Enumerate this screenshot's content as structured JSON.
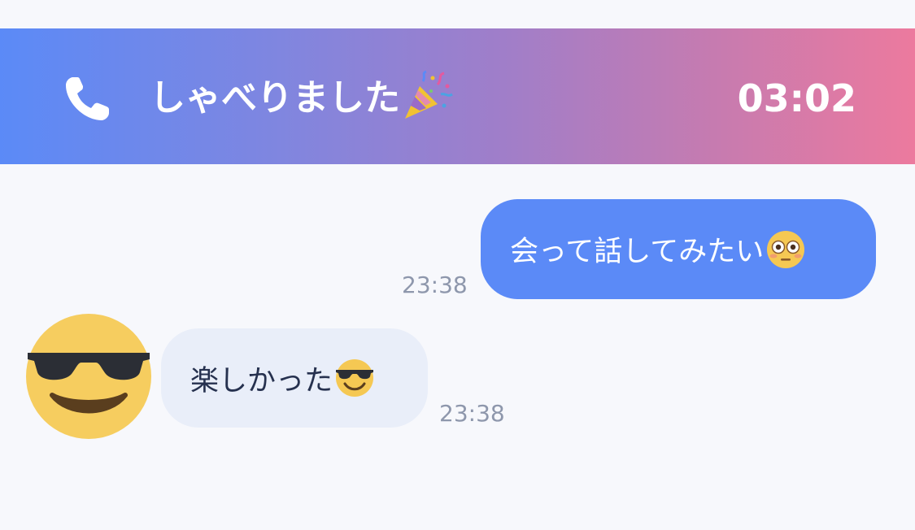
{
  "call_banner": {
    "title": "しゃべりました",
    "title_emoji": "party-popper-icon",
    "duration": "03:02",
    "icon": "phone-icon",
    "gradient_start": "#5b8af7",
    "gradient_end": "#ec7a9e"
  },
  "messages": [
    {
      "direction": "outgoing",
      "text": "会って話してみたい",
      "emoji": "flushed-face-icon",
      "time": "23:38",
      "bubble_color": "#5b8af7"
    },
    {
      "direction": "incoming",
      "text": "楽しかった",
      "emoji": "smiling-face-with-sunglasses-icon",
      "time": "23:38",
      "avatar": "sunglasses-face-avatar",
      "bubble_color": "#e9eef9"
    }
  ]
}
